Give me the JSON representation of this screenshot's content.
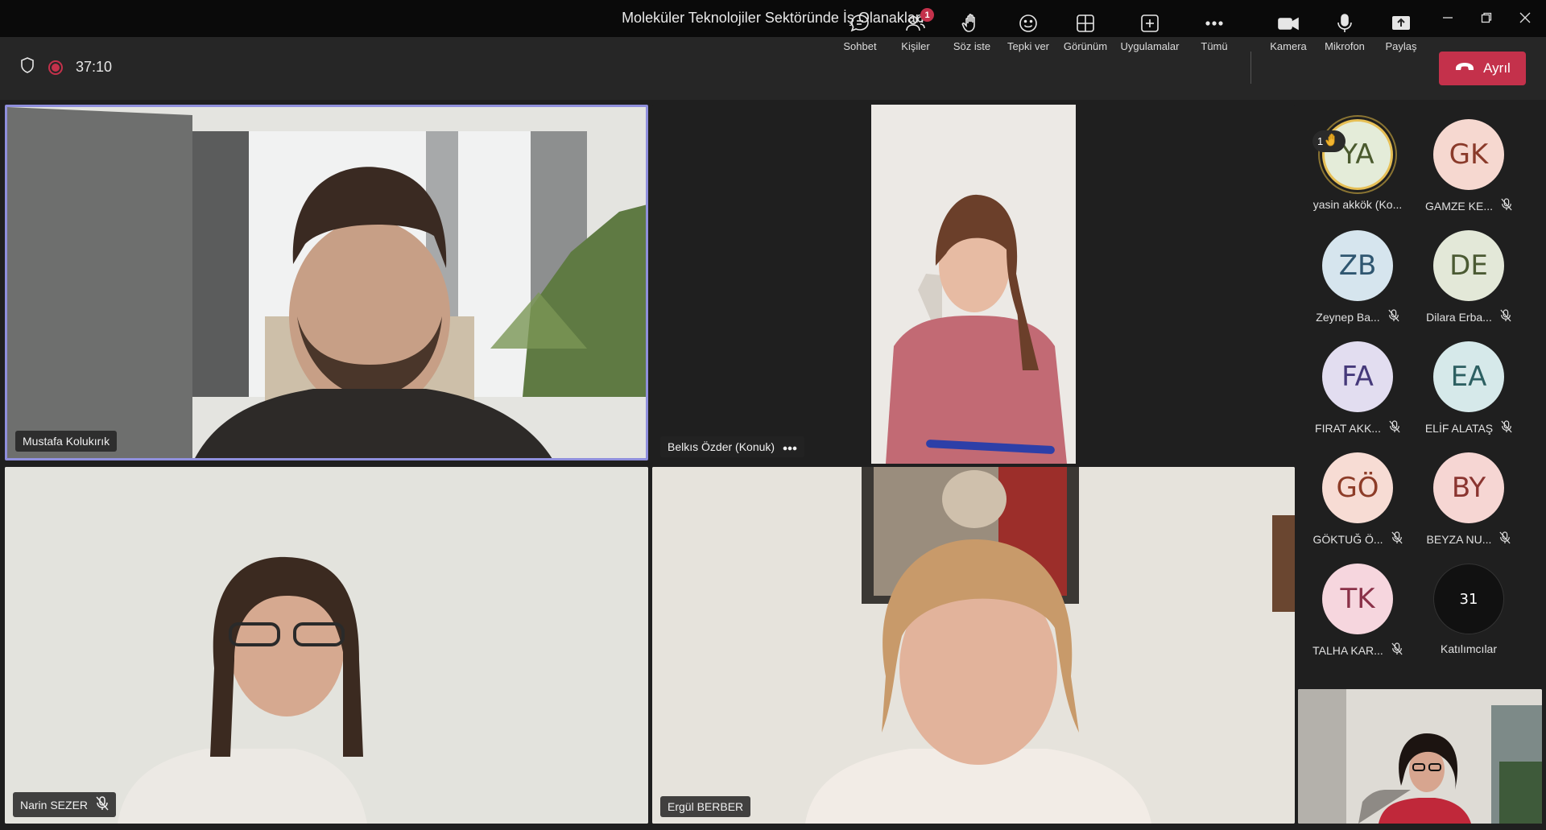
{
  "window": {
    "title": "Moleküler Teknolojiler Sektöründe İş Olanakları"
  },
  "meeting": {
    "timer": "37:10"
  },
  "toolbar": {
    "chat": "Sohbet",
    "people": "Kişiler",
    "people_badge": "1",
    "raise_hand": "Söz iste",
    "react": "Tepki ver",
    "view": "Görünüm",
    "apps": "Uygulamalar",
    "more": "Tümü",
    "camera": "Kamera",
    "mic": "Mikrofon",
    "share": "Paylaş",
    "leave": "Ayrıl"
  },
  "tiles": [
    {
      "name": "Mustafa Kolukırık"
    },
    {
      "name": "Belkıs Özder (Konuk)"
    },
    {
      "name": "Narin SEZER"
    },
    {
      "name": "Ergül BERBER"
    }
  ],
  "roster": [
    {
      "initials": "YA",
      "name": "yasin akkök (Ko...",
      "raised": "1",
      "bg": "#e4ecd9",
      "fg": "#4a5a2e"
    },
    {
      "initials": "GK",
      "name": "GAMZE KE...",
      "bg": "#f6d8d0",
      "fg": "#8a3a2a"
    },
    {
      "initials": "ZB",
      "name": "Zeynep Ba...",
      "bg": "#d6e5ee",
      "fg": "#2f5670"
    },
    {
      "initials": "DE",
      "name": "Dilara Erba...",
      "bg": "#e3e8d8",
      "fg": "#4b5a33"
    },
    {
      "initials": "FA",
      "name": "FIRAT AKK...",
      "bg": "#e2ddf0",
      "fg": "#45397a"
    },
    {
      "initials": "EA",
      "name": "ELİF ALATAŞ",
      "bg": "#d6e9ea",
      "fg": "#2d6062"
    },
    {
      "initials": "GÖ",
      "name": "GÖKTUĞ Ö...",
      "bg": "#f7dcd4",
      "fg": "#8d3c28"
    },
    {
      "initials": "BY",
      "name": "BEYZA NU...",
      "bg": "#f6d6d3",
      "fg": "#8a3530"
    },
    {
      "initials": "TK",
      "name": "TALHA KAR...",
      "bg": "#f6d6de",
      "fg": "#8a3148"
    }
  ],
  "overflow": {
    "count": "31",
    "label": "Katılımcılar"
  },
  "colors": {
    "accent": "#8f8fdc",
    "leave": "#c4314b",
    "recording": "#c4314b"
  }
}
